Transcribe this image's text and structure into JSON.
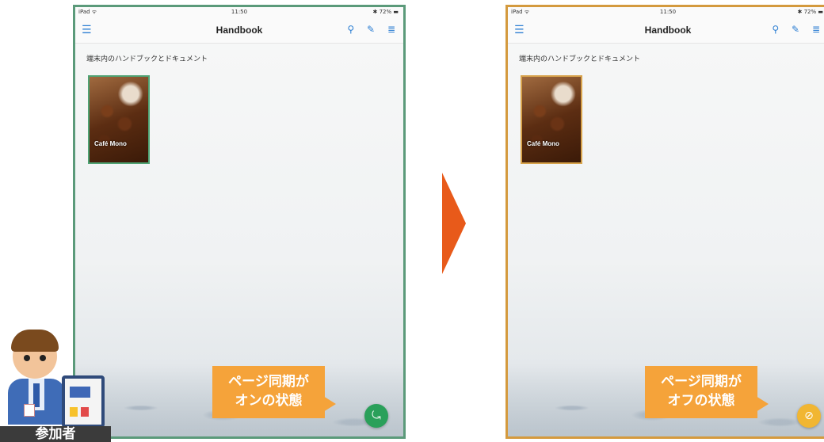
{
  "left_screen": {
    "status_left": "iPad ᯤ",
    "status_time": "11:50",
    "status_right": "✱ 72% ▬",
    "nav_title": "Handbook",
    "section_title": "端末内のハンドブックとドキュメント",
    "book_title": "Café Mono",
    "callout_line1": "ページ同期が",
    "callout_line2": "オンの状態",
    "sync_state": "on"
  },
  "right_screen": {
    "status_left": "iPad ᯤ",
    "status_time": "11:50",
    "status_right": "✱ 72% ▬",
    "nav_title": "Handbook",
    "section_title": "端末内のハンドブックとドキュメント",
    "book_title": "Café Mono",
    "callout_line1": "ページ同期が",
    "callout_line2": "オフの状態",
    "sync_state": "off"
  },
  "icons": {
    "menu": "menu-icon",
    "search": "search-icon",
    "edit": "edit-icon",
    "list": "list-icon",
    "sync_on": "sync-on-icon",
    "sync_off": "sync-off-icon"
  },
  "colors": {
    "sync_on": "#2aa05a",
    "sync_off": "#f1b632",
    "callout": "#f5a33a",
    "arrow": "#e85a1a"
  },
  "participant_label": "参加者"
}
